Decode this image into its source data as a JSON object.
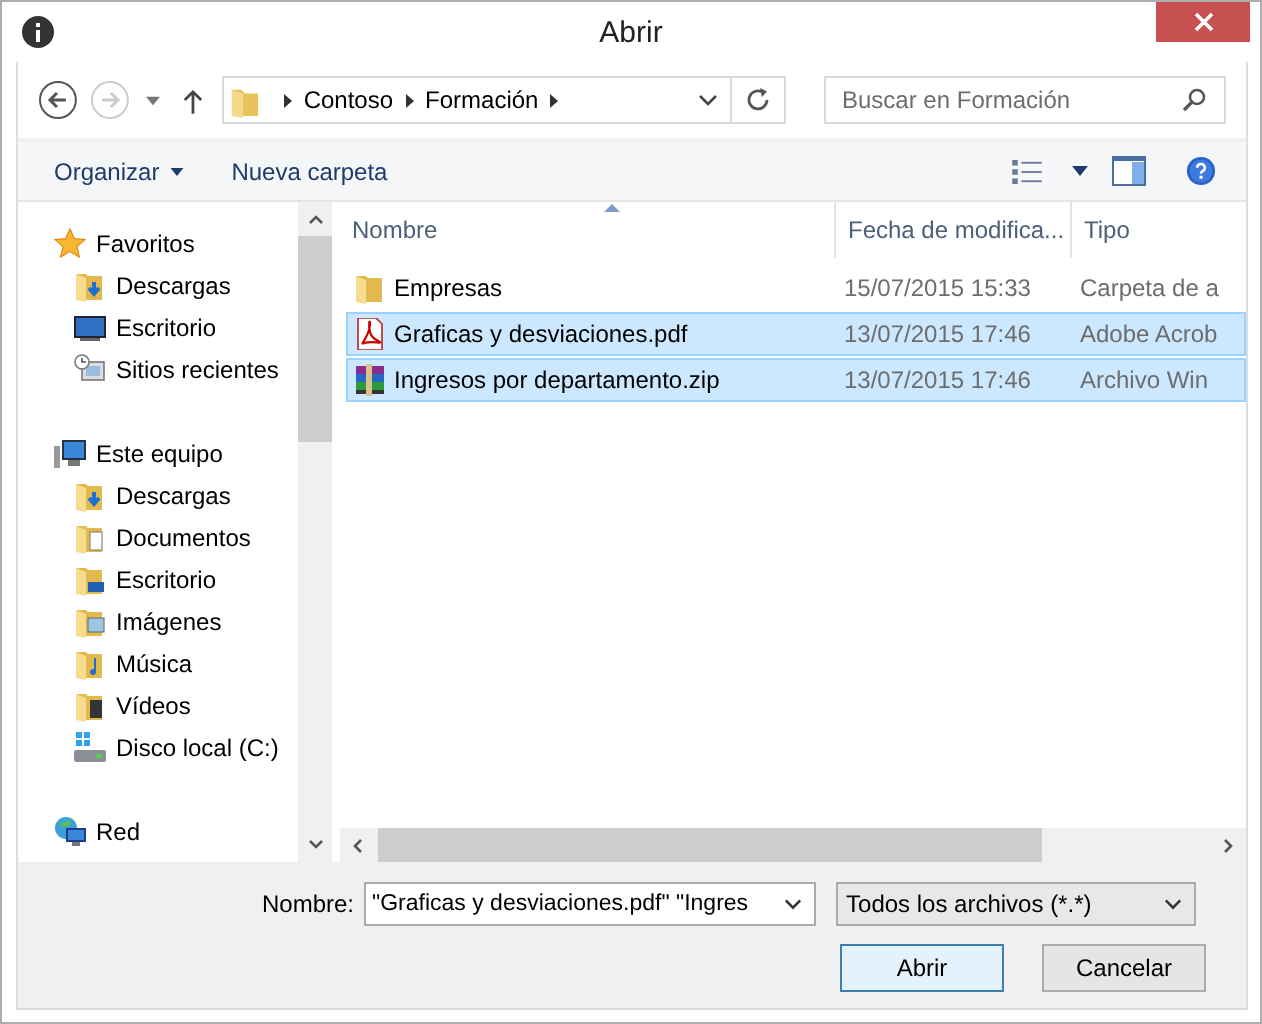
{
  "window": {
    "title": "Abrir"
  },
  "nav": {
    "breadcrumb": [
      "Contoso",
      "Formación"
    ],
    "search": {
      "placeholder": "Buscar en Formación"
    }
  },
  "toolbar": {
    "organize": "Organizar",
    "new_folder": "Nueva carpeta"
  },
  "sidebar": {
    "groups": [
      {
        "label": "Favoritos",
        "kind": "star",
        "children": [
          {
            "label": "Descargas",
            "kind": "downloads",
            "selected": false
          },
          {
            "label": "Escritorio",
            "kind": "desktop",
            "selected": false
          },
          {
            "label": "Sitios recientes",
            "kind": "recent",
            "selected": false
          }
        ]
      },
      {
        "label": "Este equipo",
        "kind": "computer",
        "children": [
          {
            "label": "Descargas",
            "kind": "downloads",
            "selected": false
          },
          {
            "label": "Documentos",
            "kind": "documents",
            "selected": false
          },
          {
            "label": "Escritorio",
            "kind": "desktop-folder",
            "selected": false
          },
          {
            "label": "Imágenes",
            "kind": "pictures",
            "selected": false
          },
          {
            "label": "Música",
            "kind": "music",
            "selected": false
          },
          {
            "label": "Vídeos",
            "kind": "videos",
            "selected": false
          },
          {
            "label": "Disco local (C:)",
            "kind": "drive",
            "selected": false
          }
        ]
      },
      {
        "label": "Red",
        "kind": "network"
      }
    ]
  },
  "files": {
    "columns": [
      "Nombre",
      "Fecha de modifica...",
      "Tipo"
    ],
    "rows": [
      {
        "name": "Empresas",
        "date": "15/07/2015 15:33",
        "type": "Carpeta de a",
        "kind": "folder",
        "selected": false
      },
      {
        "name": "Graficas y desviaciones.pdf",
        "date": "13/07/2015 17:46",
        "type": "Adobe Acrob",
        "kind": "pdf",
        "selected": true
      },
      {
        "name": "Ingresos por departamento.zip",
        "date": "13/07/2015 17:46",
        "type": "Archivo Win",
        "kind": "zip",
        "selected": true
      }
    ]
  },
  "footer": {
    "name_label": "Nombre:",
    "name_value": "\"Graficas y desviaciones.pdf\" \"Ingres",
    "filter": "Todos los archivos (*.*)",
    "buttons": [
      "Abrir",
      "Cancelar"
    ]
  }
}
